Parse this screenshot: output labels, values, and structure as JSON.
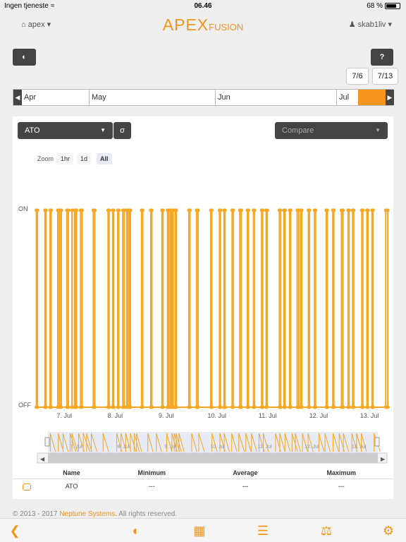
{
  "status": {
    "carrier": "Ingen tjeneste",
    "time": "06.46",
    "battery": "68 %"
  },
  "header": {
    "site": "apex",
    "brand_main": "APEX",
    "brand_sub": "FUSION",
    "user": "skab1liv"
  },
  "toolbar": {
    "dashboard_icon": "dashboard-gauge-icon",
    "help_label": "?"
  },
  "date_range": {
    "start": "7/6",
    "end": "7/13"
  },
  "timeline": {
    "months": [
      "Apr",
      "May",
      "Jun",
      "Jul"
    ]
  },
  "selector": {
    "outlet": "ATO",
    "sigma": "σ",
    "compare_placeholder": "Compare"
  },
  "zoom": {
    "label": "Zoom",
    "options": [
      "1hr",
      "1d",
      "All"
    ],
    "active": "All"
  },
  "chart_data": {
    "type": "line",
    "title": "",
    "ylabel": "",
    "y_categories": [
      "OFF",
      "ON"
    ],
    "x_ticks": [
      "7. Jul",
      "8. Jul",
      "9. Jul",
      "10. Jul",
      "11. Jul",
      "12. Jul",
      "13. Jul"
    ],
    "xlim": [
      6.4,
      13.4
    ],
    "series": [
      {
        "color": "#f7a722",
        "on_pulses": [
          [
            6.45,
            6.47
          ],
          [
            6.62,
            6.64
          ],
          [
            6.72,
            6.74
          ],
          [
            6.87,
            6.9
          ],
          [
            6.91,
            6.94
          ],
          [
            7.05,
            7.08
          ],
          [
            7.15,
            7.2
          ],
          [
            7.22,
            7.24
          ],
          [
            7.32,
            7.35
          ],
          [
            7.57,
            7.6
          ],
          [
            7.86,
            7.88
          ],
          [
            7.95,
            7.97
          ],
          [
            8.05,
            8.07
          ],
          [
            8.15,
            8.18
          ],
          [
            8.23,
            8.25
          ],
          [
            8.28,
            8.3
          ],
          [
            8.52,
            8.54
          ],
          [
            8.7,
            8.72
          ],
          [
            8.92,
            8.94
          ],
          [
            9.03,
            9.05
          ],
          [
            9.08,
            9.1
          ],
          [
            9.12,
            9.14
          ],
          [
            9.18,
            9.2
          ],
          [
            9.45,
            9.47
          ],
          [
            9.6,
            9.63
          ],
          [
            9.88,
            9.9
          ],
          [
            10.05,
            10.07
          ],
          [
            10.14,
            10.16
          ],
          [
            10.3,
            10.32
          ],
          [
            10.45,
            10.48
          ],
          [
            10.6,
            10.62
          ],
          [
            10.72,
            10.74
          ],
          [
            10.88,
            10.9
          ],
          [
            10.97,
            10.99
          ],
          [
            11.23,
            11.25
          ],
          [
            11.32,
            11.34
          ],
          [
            11.43,
            11.45
          ],
          [
            11.58,
            11.61
          ],
          [
            11.65,
            11.67
          ],
          [
            11.8,
            11.82
          ],
          [
            11.92,
            11.94
          ],
          [
            12.15,
            12.17
          ],
          [
            12.28,
            12.3
          ],
          [
            12.45,
            12.48
          ],
          [
            12.58,
            12.6
          ],
          [
            12.67,
            12.69
          ],
          [
            12.85,
            12.87
          ],
          [
            12.95,
            12.97
          ],
          [
            13.05,
            13.07
          ],
          [
            13.32,
            13.36
          ]
        ]
      }
    ]
  },
  "navigator": {
    "x_ticks": [
      "7. Jul",
      "8. Jul",
      "9. Jul",
      "10. Jul",
      "11. Jul",
      "12. Jul",
      "13. Jul"
    ]
  },
  "stats": {
    "headers": [
      "Name",
      "Minimum",
      "Average",
      "Maximum"
    ],
    "row": {
      "name": "ATO",
      "min": "---",
      "avg": "---",
      "max": "---",
      "icon": "outlet-icon"
    }
  },
  "footer": {
    "copyright": "© 2013 - 2017",
    "company": "Neptune Systems",
    "rights": ". All rights reserved."
  },
  "tabbar": {
    "items": [
      "back-icon",
      "dashboard-icon",
      "calendar-icon",
      "log-icon",
      "flask-icon",
      "gear-icon"
    ]
  }
}
